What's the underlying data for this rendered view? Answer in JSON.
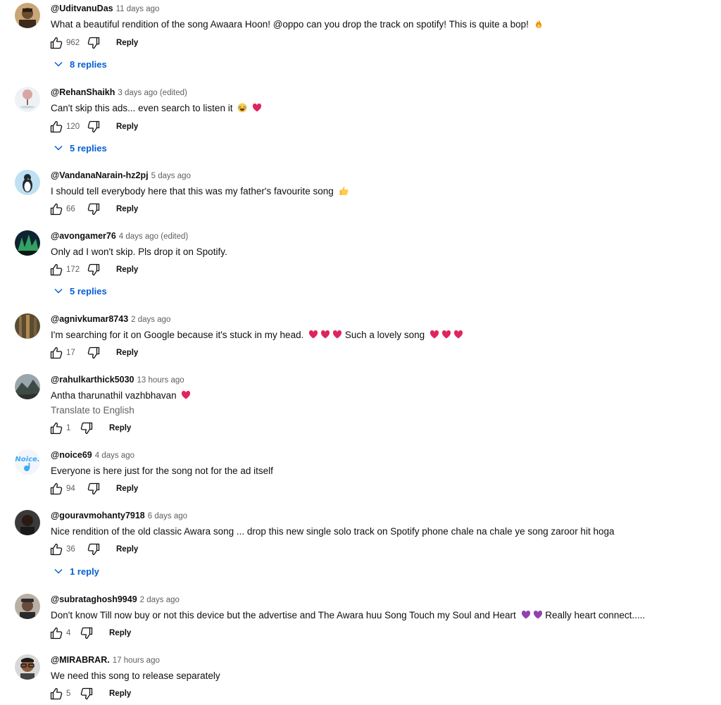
{
  "comments": [
    {
      "author": "@UditvanuDas",
      "time": "11 days ago",
      "text": "What a beautiful rendition of the song Awaara Hoon! @oppo can you drop the track on spotify! This is quite a bop!",
      "emojis": [
        "fire"
      ],
      "likes": "962",
      "reply_label": "Reply",
      "replies": "8 replies",
      "avatar": "avatar-man-photo"
    },
    {
      "author": "@RehanShaikh",
      "time": "3 days ago (edited)",
      "text": "Can't skip this ads... even search to listen it",
      "emojis": [
        "laughing",
        "red-heart"
      ],
      "likes": "120",
      "reply_label": "Reply",
      "replies": "5 replies",
      "avatar": "avatar-tree-illustration"
    },
    {
      "author": "@VandanaNarain-hz2pj",
      "time": "5 days ago",
      "text": "I should tell everybody here that this was my father's favourite song",
      "emojis": [
        "thumbs-up"
      ],
      "likes": "66",
      "reply_label": "Reply",
      "replies": "",
      "avatar": "avatar-penguin"
    },
    {
      "author": "@avongamer76",
      "time": "4 days ago (edited)",
      "text": "Only ad I won't skip. Pls drop it on Spotify.",
      "emojis": [],
      "likes": "172",
      "reply_label": "Reply",
      "replies": "5 replies",
      "avatar": "avatar-aurora"
    },
    {
      "author": "@agnivkumar8743",
      "time": "2 days ago",
      "text": "I'm searching for it on Google because it's stuck in my head.",
      "text2": "Such a lovely song",
      "emojis": [
        "red-heart",
        "red-heart",
        "red-heart"
      ],
      "emojis2": [
        "red-heart",
        "red-heart",
        "red-heart"
      ],
      "likes": "17",
      "reply_label": "Reply",
      "replies": "",
      "avatar": "avatar-forest"
    },
    {
      "author": "@rahulkarthick5030",
      "time": "13 hours ago",
      "text": "Antha tharunathil vazhbhavan",
      "emojis": [
        "red-heart"
      ],
      "translate": "Translate to English",
      "likes": "1",
      "reply_label": "Reply",
      "replies": "",
      "avatar": "avatar-mountain"
    },
    {
      "author": "@noice69",
      "time": "4 days ago",
      "text": "Everyone is here just for the song not for the ad itself",
      "emojis": [],
      "likes": "94",
      "reply_label": "Reply",
      "replies": "",
      "avatar": "avatar-noice-logo",
      "avatar_text": "Noice."
    },
    {
      "author": "@gouravmohanty7918",
      "time": "6 days ago",
      "text": "Nice rendition of the old classic Awara song ... drop this new single solo track on Spotify phone chale na chale ye song zaroor hit hoga",
      "emojis": [],
      "likes": "36",
      "reply_label": "Reply",
      "replies": "1 reply",
      "avatar": "avatar-man-dark"
    },
    {
      "author": "@subrataghosh9949",
      "time": "2 days ago",
      "text": "Don't know Till now buy or not this device but the advertise and The Awara huu Song Touch my Soul and Heart",
      "text2": "Really heart connect.....",
      "emojis": [
        "purple-heart",
        "purple-heart"
      ],
      "emojis2": [],
      "likes": "4",
      "reply_label": "Reply",
      "replies": "",
      "avatar": "avatar-man-cap"
    },
    {
      "author": "@MIRABRAR.",
      "time": "17 hours ago",
      "text": "We need this song to release separately",
      "emojis": [],
      "likes": "5",
      "reply_label": "Reply",
      "replies": "",
      "avatar": "avatar-man-glasses"
    }
  ],
  "colors": {
    "link_blue": "#065fd4",
    "text_primary": "#0f0f0f",
    "text_secondary": "#606060",
    "red_heart": "#e0245e",
    "purple_heart": "#8e44ad",
    "fire": "#f4900c"
  }
}
